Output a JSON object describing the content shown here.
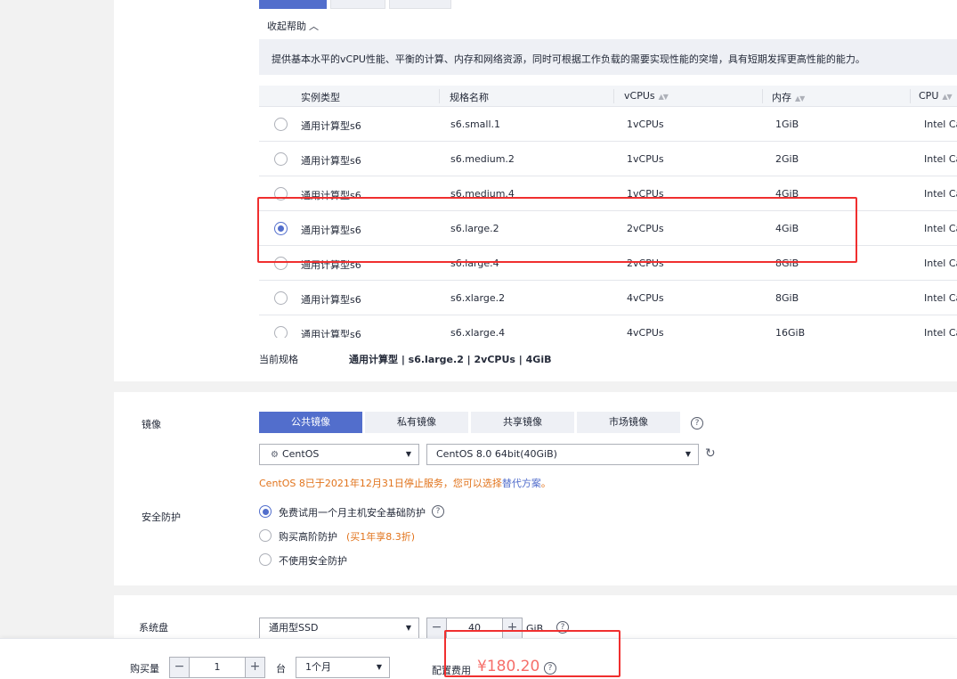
{
  "help": {
    "collapse_label": "收起帮助",
    "text": "提供基本水平的vCPU性能、平衡的计算、内存和网络资源，同时可根据工作负载的需要实现性能的突增，具有短期发挥更高性能的能力。"
  },
  "table": {
    "headers": [
      "实例类型",
      "规格名称",
      "vCPUs",
      "内存",
      "CPU"
    ],
    "rows": [
      {
        "type": "通用计算型s6",
        "name": "s6.small.1",
        "vcpus": "1vCPUs",
        "mem": "1GiB",
        "cpu": "Intel Ca",
        "selected": false
      },
      {
        "type": "通用计算型s6",
        "name": "s6.medium.2",
        "vcpus": "1vCPUs",
        "mem": "2GiB",
        "cpu": "Intel Ca",
        "selected": false
      },
      {
        "type": "通用计算型s6",
        "name": "s6.medium.4",
        "vcpus": "1vCPUs",
        "mem": "4GiB",
        "cpu": "Intel Ca",
        "selected": false
      },
      {
        "type": "通用计算型s6",
        "name": "s6.large.2",
        "vcpus": "2vCPUs",
        "mem": "4GiB",
        "cpu": "Intel Ca",
        "selected": true
      },
      {
        "type": "通用计算型s6",
        "name": "s6.large.4",
        "vcpus": "2vCPUs",
        "mem": "8GiB",
        "cpu": "Intel Ca",
        "selected": false
      },
      {
        "type": "通用计算型s6",
        "name": "s6.xlarge.2",
        "vcpus": "4vCPUs",
        "mem": "8GiB",
        "cpu": "Intel Ca",
        "selected": false
      },
      {
        "type": "通用计算型s6",
        "name": "s6.xlarge.4",
        "vcpus": "4vCPUs",
        "mem": "16GiB",
        "cpu": "Intel Ca",
        "selected": false
      }
    ]
  },
  "current_spec": {
    "label": "当前规格",
    "value": "通用计算型 | s6.large.2 | 2vCPUs | 4GiB"
  },
  "image": {
    "label": "镜像",
    "tabs": [
      "公共镜像",
      "私有镜像",
      "共享镜像",
      "市场镜像"
    ],
    "help": "?",
    "os_select": "CentOS",
    "version_select": "CentOS 8.0 64bit(40GiB)",
    "warning": "CentOS 8已于2021年12月31日停止服务，您可以选择",
    "warning_link": "替代方案",
    "warning_end": "。"
  },
  "security": {
    "label": "安全防护",
    "options": [
      {
        "label": "免费试用一个月主机安全基础防护",
        "note": "",
        "selected": true
      },
      {
        "label": "购买高阶防护",
        "note": "(买1年享8.3折)",
        "selected": false
      },
      {
        "label": "不使用安全防护",
        "note": "",
        "selected": false
      }
    ]
  },
  "disk": {
    "label": "系统盘",
    "type": "通用型SSD",
    "size": "40",
    "unit": "GiB"
  },
  "purchase": {
    "qty_label": "购买量",
    "qty": "1",
    "unit": "台",
    "duration": "1个月",
    "fee_label": "配置费用",
    "fee": "¥180.20"
  },
  "colors": {
    "accent": "#526ecc",
    "price": "#f66f6a",
    "warning": "#e1731b",
    "highlight_box": "#f02f2f"
  }
}
